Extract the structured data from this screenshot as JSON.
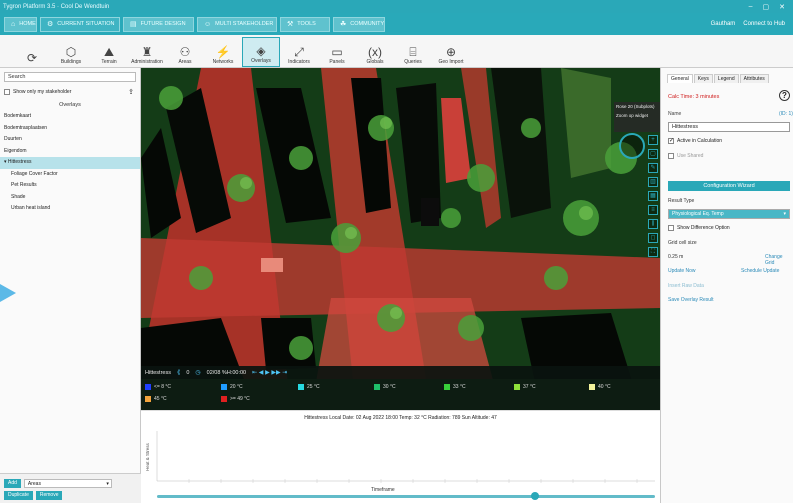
{
  "window": {
    "title": "Tygron Platform 3.5 · Cool De Wendtuin",
    "controls": [
      "–",
      "▢",
      "✕"
    ]
  },
  "tabs": [
    {
      "label": "HOME",
      "icon": "home"
    },
    {
      "label": "CURRENT SITUATION",
      "icon": "gear"
    },
    {
      "label": "FUTURE DESIGN",
      "icon": "doc"
    },
    {
      "label": "MULTI STAKEHOLDER",
      "icon": "people"
    },
    {
      "label": "TOOLS",
      "icon": "tools"
    },
    {
      "label": "COMMUNITY",
      "icon": "community"
    }
  ],
  "user": {
    "name": "Gautham",
    "link": "Connect to Hub"
  },
  "toolbar": [
    {
      "label": "",
      "icon": "refresh-icon"
    },
    {
      "label": "Buildings",
      "icon": "building-icon"
    },
    {
      "label": "Terrain",
      "icon": "terrain-icon"
    },
    {
      "label": "Administration",
      "icon": "admin-icon"
    },
    {
      "label": "Areas",
      "icon": "areas-icon"
    },
    {
      "label": "Networks",
      "icon": "network-icon"
    },
    {
      "label": "Overlays",
      "icon": "overlay-icon",
      "selected": true
    },
    {
      "label": "Indicators",
      "icon": "indicator-icon"
    },
    {
      "label": "Panels",
      "icon": "panel-icon"
    },
    {
      "label": "Globals",
      "icon": "globals-icon"
    },
    {
      "label": "Queries",
      "icon": "query-icon"
    },
    {
      "label": "Geo Import",
      "icon": "geoimport-icon"
    }
  ],
  "left": {
    "search_placeholder": "Search",
    "show_only_label": "Show only my stakeholder",
    "header": "Overlays",
    "items": [
      {
        "label": "Bodemkaart",
        "sub": false
      },
      {
        "label": "Bodemtrasplaatsen",
        "sub": false
      },
      {
        "label": "Duurten",
        "sub": false
      },
      {
        "label": "Eigendom",
        "sub": false
      },
      {
        "label": "▾ Hittestress",
        "sub": false,
        "selected": true
      },
      {
        "label": "Foliage Cover Factor",
        "sub": true
      },
      {
        "label": "Pet Results",
        "sub": true
      },
      {
        "label": "Shade",
        "sub": true
      },
      {
        "label": "Urban heat island",
        "sub": true
      }
    ],
    "bottom": {
      "add": "Add",
      "combo": "Areas",
      "duplicate": "Duplicate",
      "remove": "Remove"
    }
  },
  "view": {
    "info_line1": "Rose 20 (Subplots)",
    "info_line2": "Zoom op widget",
    "time": {
      "overlay": "Hittestress",
      "value": "0",
      "clock": "02/08 %H:00:00"
    },
    "legend": [
      {
        "label": "<= 8 °C",
        "color": "#1f3fff"
      },
      {
        "label": "20 °C",
        "color": "#1f9cff"
      },
      {
        "label": "25 °C",
        "color": "#27d9e0"
      },
      {
        "label": "30 °C",
        "color": "#1fbf6a"
      },
      {
        "label": "33 °C",
        "color": "#38d03a"
      },
      {
        "label": "37 °C",
        "color": "#8fe03a"
      },
      {
        "label": "40 °C",
        "color": "#f2f29a"
      },
      {
        "label": "45 °C",
        "color": "#f3a33d"
      },
      {
        "label": ">= 49 °C",
        "color": "#e02020"
      }
    ]
  },
  "chart": {
    "title": "Hittestress Local Date: 02 Aug 2022 18:00 Temp: 32 °C Radiation: 789 Sun Altitude: 47",
    "ylabel": "Heat & Stress",
    "xlabel": "Timeframe",
    "slider_fraction": 0.76
  },
  "right": {
    "tabs": [
      "General",
      "Keys",
      "Legend",
      "Attributes"
    ],
    "calc_time": "Calc Time: 3 minutes",
    "name_label": "Name",
    "id_label": "(ID: 1)",
    "name_value": "Hittestress",
    "active_label": "Active in Calculation",
    "use_shared_label": "Use Shared",
    "wizard_label": "Configuration Wizard",
    "result_type_label": "Result Type",
    "result_type_value": "Physiological Eq. Temp",
    "show_diff_label": "Show Difference Option",
    "grid_cell_label": "Grid cell size",
    "grid_cell_value": "0.25 m",
    "change_grid": "Change Grid",
    "update_now": "Update Now",
    "schedule_update": "Schedule Update",
    "insert_data": "Insert Raw Data",
    "save_overlay": "Save Overlay Result"
  }
}
